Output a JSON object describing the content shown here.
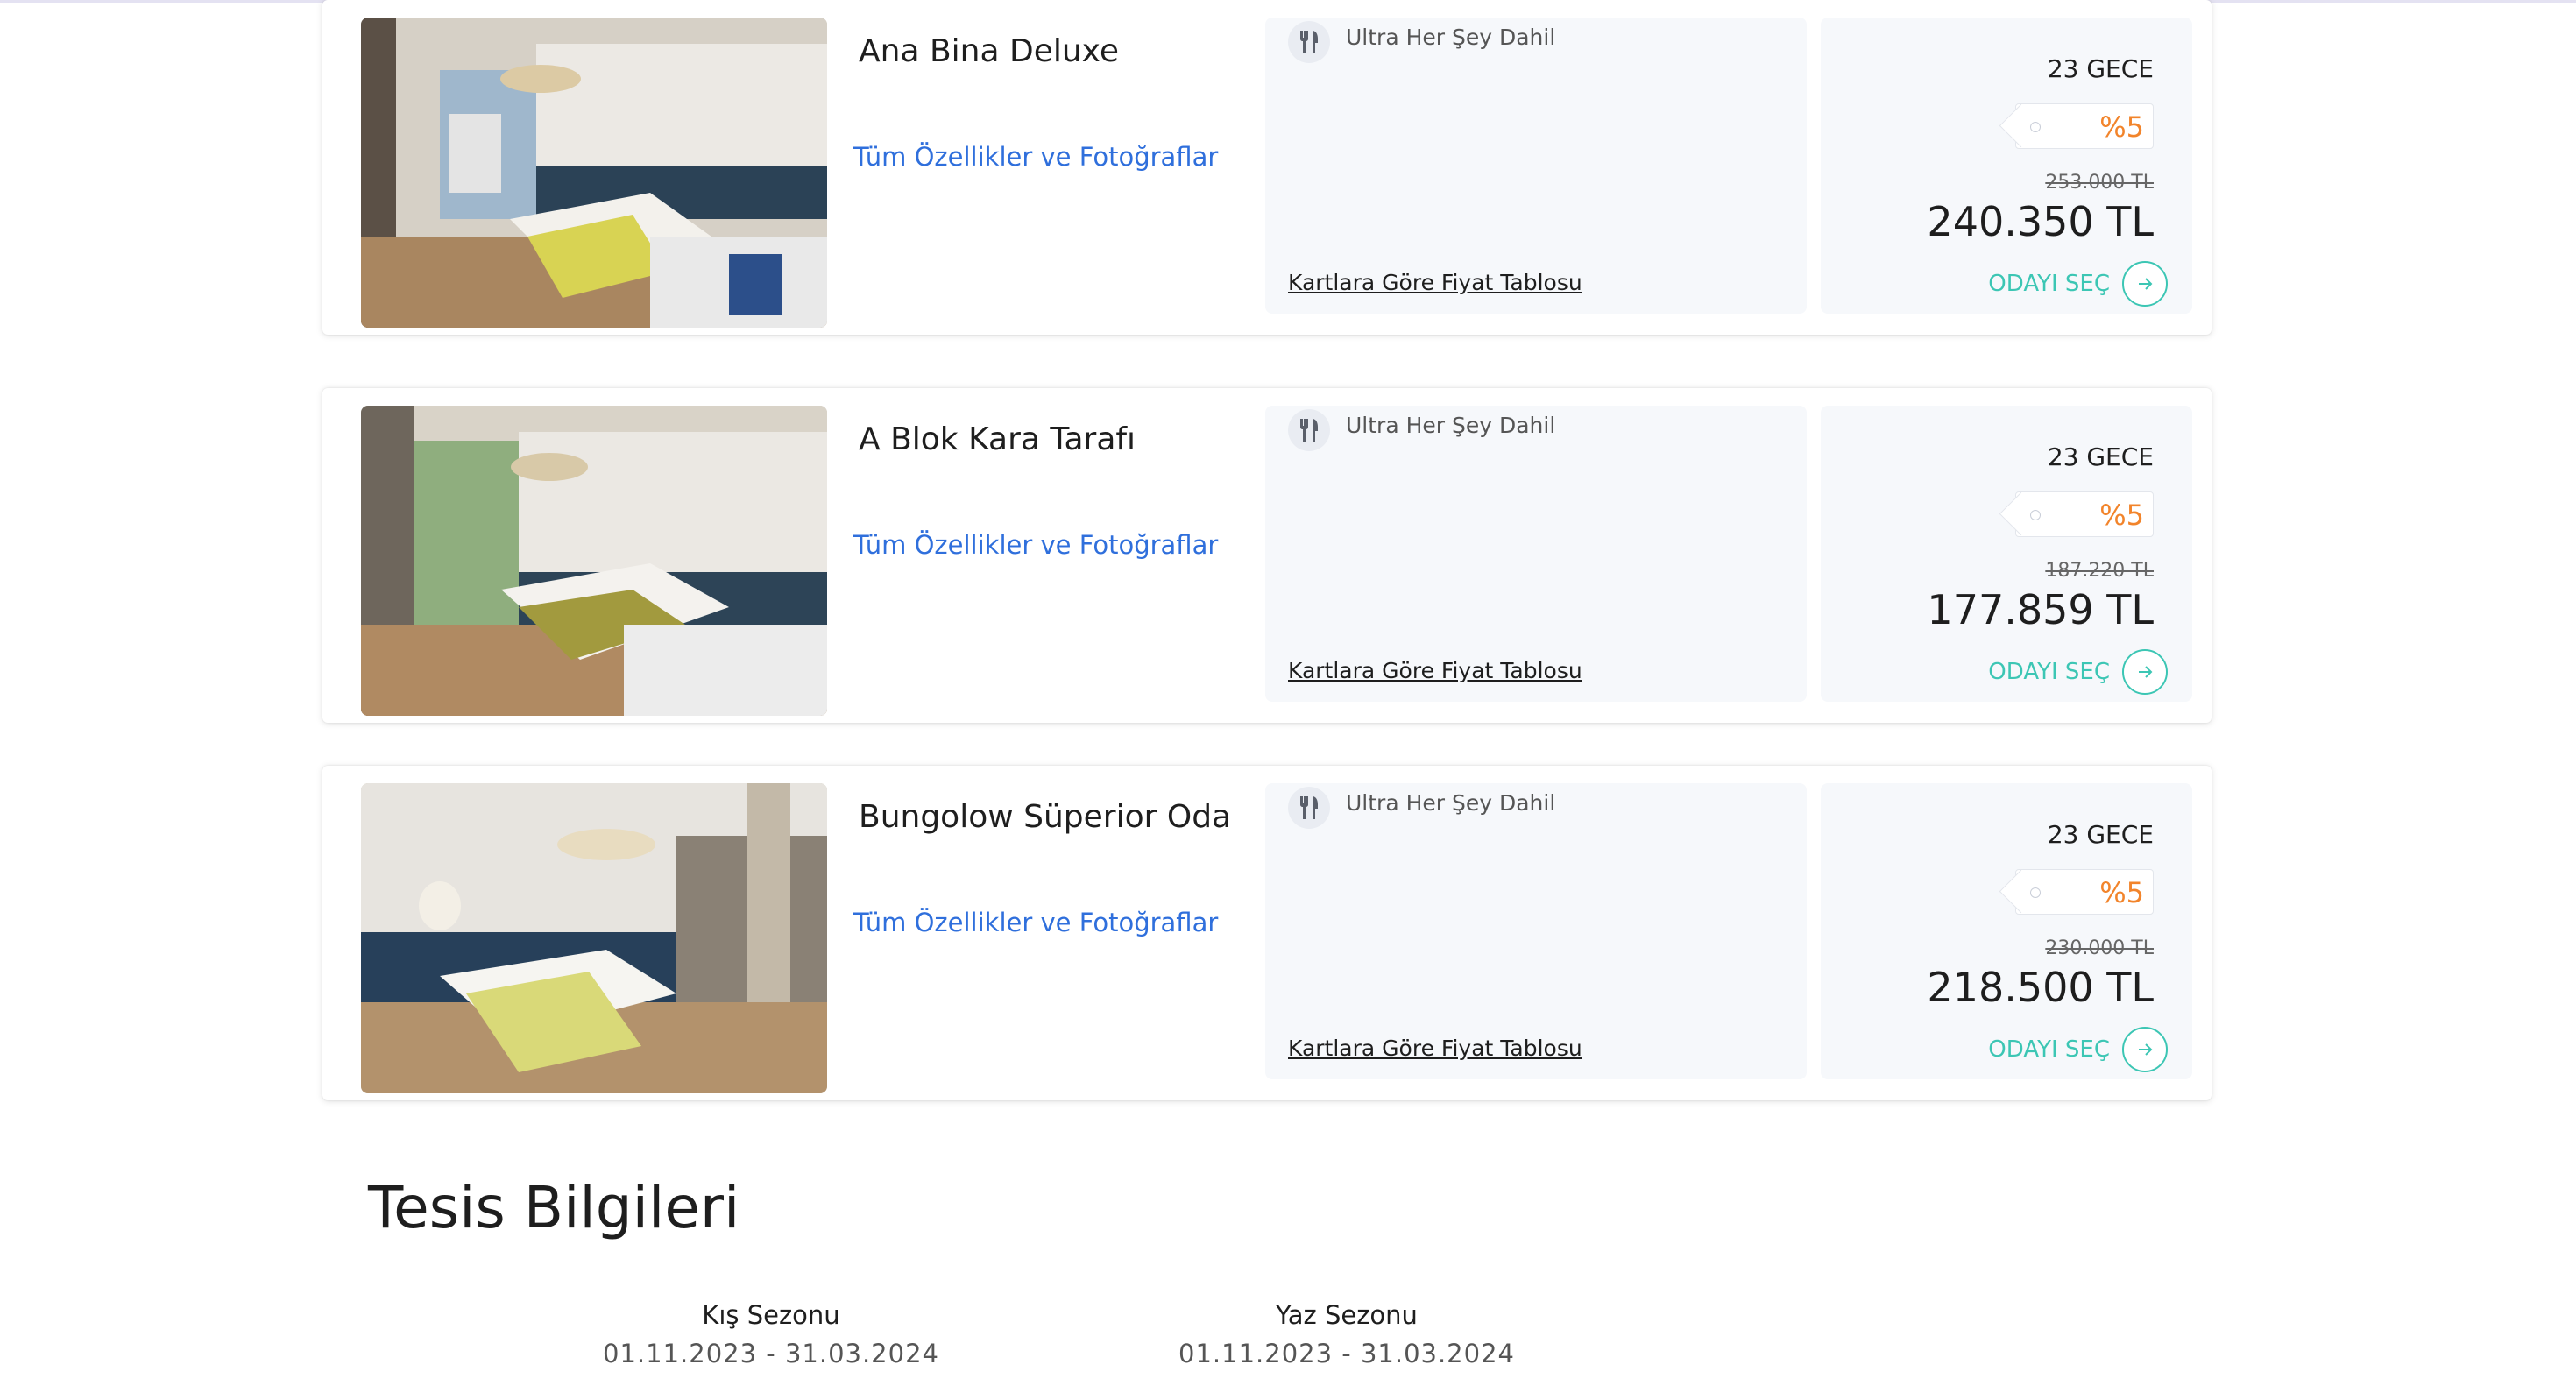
{
  "rooms": [
    {
      "title": "A Blok Kara Tarafı",
      "features_link": "Tüm Özellikler ve Fotoğraflar",
      "board": "Ultra Her Şey Dahil",
      "price_table_link": "Kartlara Göre Fiyat Tablosu",
      "nights": "23 GECE",
      "discount": "%5",
      "old_price": "187.220 TL",
      "price": "177.859 TL",
      "select_label": "ODAYI SEÇ"
    },
    {
      "title": "Bungolow Süperior Oda",
      "features_link": "Tüm Özellikler ve Fotoğraflar",
      "board": "Ultra Her Şey Dahil",
      "price_table_link": "Kartlara Göre Fiyat Tablosu",
      "nights": "23 GECE",
      "discount": "%5",
      "old_price": "230.000 TL",
      "price": "218.500 TL",
      "select_label": "ODAYI SEÇ"
    },
    {
      "title": "Ana Bina Deluxe",
      "features_link": "Tüm Özellikler ve Fotoğraflar",
      "board": "Ultra Her Şey Dahil",
      "price_table_link": "Kartlara Göre Fiyat Tablosu",
      "nights": "23 GECE",
      "discount": "%5",
      "old_price": "253.000 TL",
      "price": "240.350 TL",
      "select_label": "ODAYI SEÇ"
    }
  ],
  "facility": {
    "title": "Tesis Bilgileri",
    "seasons": [
      {
        "name": "Kış Sezonu",
        "dates": "01.11.2023 - 31.03.2024"
      },
      {
        "name": "Yaz Sezonu",
        "dates": "01.11.2023 - 31.03.2024"
      }
    ]
  },
  "icons": {
    "board": "cutlery-icon",
    "select": "arrow-right-icon"
  },
  "colors": {
    "link": "#2f6fdc",
    "discount": "#f2842b",
    "select": "#3cc6b4",
    "panel_bg": "#f6f8fb"
  }
}
